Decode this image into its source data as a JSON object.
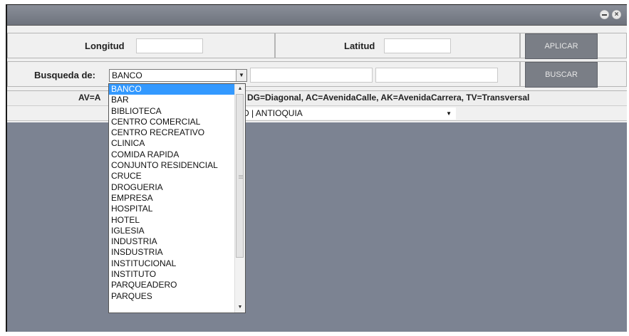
{
  "window": {
    "minimize_icon": "minimize-icon",
    "close_icon": "close-icon"
  },
  "coords": {
    "longitud_label": "Longitud",
    "longitud_value": "",
    "latitud_label": "Latitud",
    "latitud_value": "",
    "apply_label": "APLICAR"
  },
  "search": {
    "label": "Busqueda de:",
    "type_selected": "BANCO",
    "field1_value": "",
    "field2_value": "",
    "search_label": "BUSCAR"
  },
  "info_text": "DG=Diagonal, AC=AvenidaCalle, AK=AvenidaCarrera, TV=Transversal",
  "info_prefix": "AV=A",
  "city_selected": "LLO | ANTIOQUIA",
  "dropdown": {
    "options": [
      "BANCO",
      "BAR",
      "BIBLIOTECA",
      "CENTRO COMERCIAL",
      "CENTRO RECREATIVO",
      "CLINICA",
      "COMIDA RAPIDA",
      "CONJUNTO RESIDENCIAL",
      "CRUCE",
      "DROGUERIA",
      "EMPRESA",
      "HOSPITAL",
      "HOTEL",
      "IGLESIA",
      "INDUSTRIA",
      "INSDUSTRIA",
      "INSTITUCIONAL",
      "INSTITUTO",
      "PARQUEADERO",
      "PARQUES"
    ],
    "selected_index": 0
  }
}
